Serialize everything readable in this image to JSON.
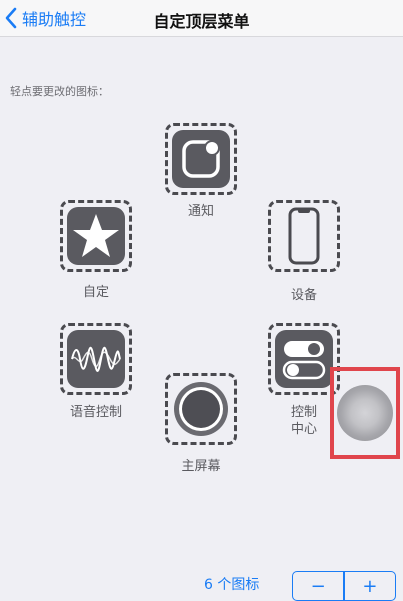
{
  "nav": {
    "back_label": "辅助触控",
    "title": "自定顶层菜单"
  },
  "hint": "轻点要更改的图标：",
  "icons": {
    "notification": "通知",
    "custom": "自定",
    "device": "设备",
    "voice_control": "语音控制",
    "control_center_line1": "控制",
    "control_center_line2": "中心",
    "home": "主屏幕"
  },
  "bottom": {
    "count_label": "6 个图标",
    "minus": "−",
    "plus": "+"
  },
  "colors": {
    "accent": "#1a7cf5",
    "highlight_border": "#e0454c",
    "tile": "#5a5a60"
  }
}
